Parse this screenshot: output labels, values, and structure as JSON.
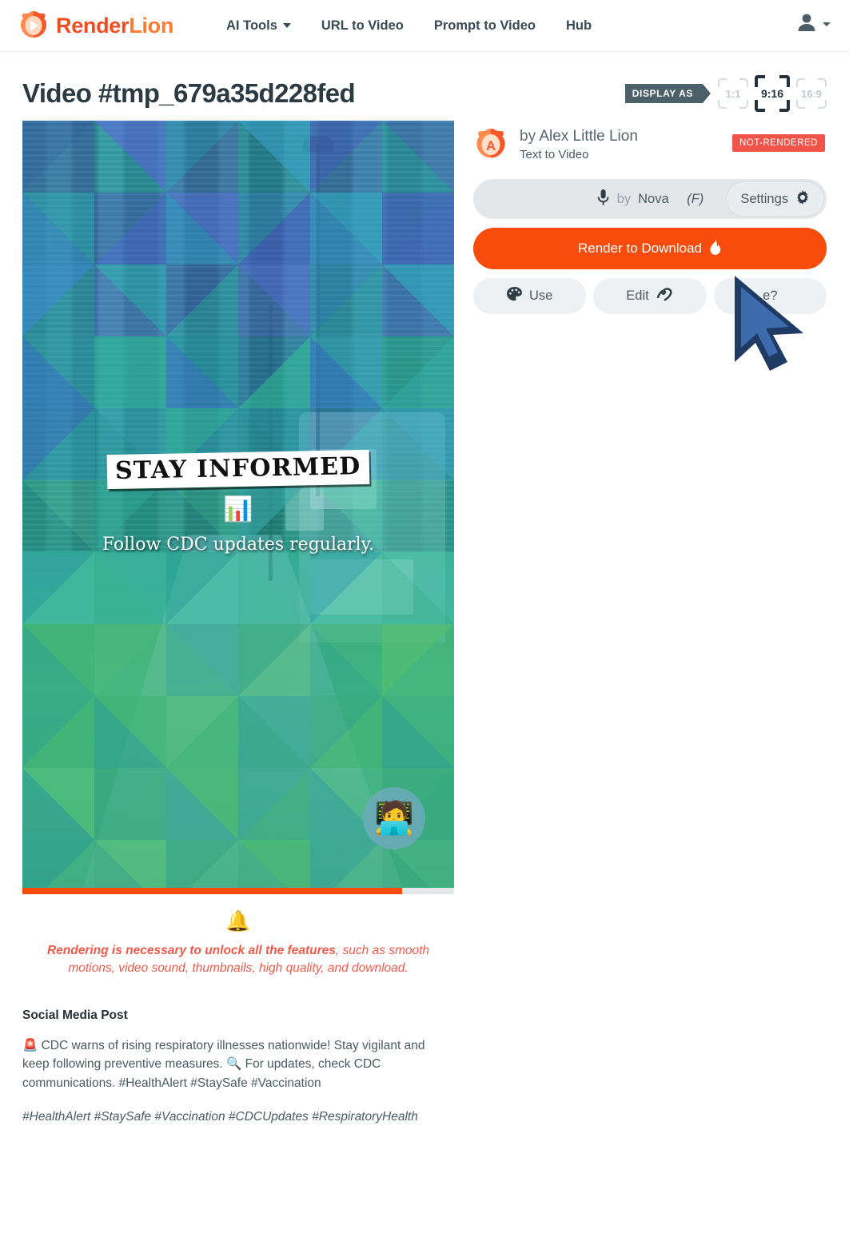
{
  "header": {
    "logo": {
      "icon": "lion-play-icon",
      "text_primary": "Render",
      "text_secondary": "Lion"
    },
    "nav": [
      {
        "label": "AI Tools",
        "has_caret": true
      },
      {
        "label": "URL to Video",
        "has_caret": false
      },
      {
        "label": "Prompt to Video",
        "has_caret": false
      },
      {
        "label": "Hub",
        "has_caret": false
      }
    ],
    "account_icon": "user-icon",
    "account_caret": "chevron-down-icon"
  },
  "page": {
    "title": "Video #tmp_679a35d228fed",
    "display_as_label": "DISPLAY AS",
    "ratios": [
      {
        "label": "1:1",
        "selected": false
      },
      {
        "label": "9:16",
        "selected": true
      },
      {
        "label": "16:9",
        "selected": false
      }
    ]
  },
  "video": {
    "headline": "STAY INFORMED",
    "emoji": "📊",
    "subtitle": "Follow CDC updates regularly.",
    "corner_badge_emoji": "🧑‍💻",
    "progress_percent": 88,
    "progress_color": "#f84c0c"
  },
  "notice": {
    "icon": "alert-bell-icon",
    "bell": "🔔",
    "strong": "Rendering is necessary to unlock all the features",
    "rest": ", such as smooth motions, video sound, thumbnails, high quality, and download.",
    "color": "#f2594a"
  },
  "social_media_post": {
    "title": "Social Media Post",
    "body": "🚨 CDC warns of rising respiratory illnesses nationwide! Stay vigilant and keep following preventive measures. 🔍 For updates, check CDC communications. #HealthAlert #StaySafe #Vaccination",
    "hashtags": "#HealthAlert #StaySafe #Vaccination #CDCUpdates #RespiratoryHealth"
  },
  "sidebar": {
    "author_prefix": "by ",
    "author_name": "Alex Little Lion",
    "author_initial": "A",
    "content_kind": "Text to Video",
    "status": "NOT-RENDERED",
    "status_color": "#f2544a",
    "voice": {
      "mic_icon": "microphone-icon",
      "prefix": "by ",
      "name": "Nova",
      "gender": "(F)",
      "settings_label": "Settings",
      "settings_icon": "gear-icon"
    },
    "render_button": {
      "label": "Render to Download",
      "icon": "fire-icon",
      "glyph": "🔥",
      "color": "#f74c0b"
    },
    "actions": [
      {
        "label": "Use",
        "icon": "palette-icon",
        "glyph": "🎨",
        "icon_side": "left"
      },
      {
        "label": "Edit",
        "icon": "squiggle-icon",
        "glyph": "〰",
        "icon_side": "right"
      },
      {
        "label": "e?",
        "icon": "",
        "glyph": "",
        "icon_side": "right",
        "occluded_by_cursor": true
      }
    ]
  }
}
